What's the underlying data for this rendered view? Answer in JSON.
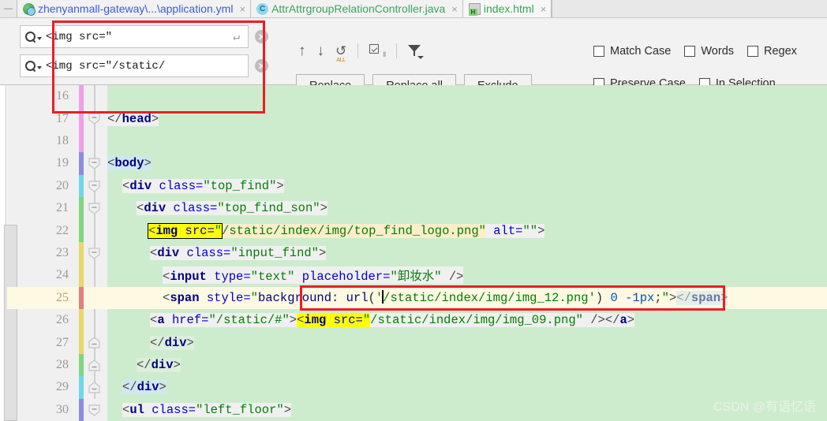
{
  "tabs": [
    {
      "label": "zhenyanmall-gateway\\...\\application.yml",
      "icon": "yml-file-icon",
      "close": "×",
      "active": false
    },
    {
      "label": "AttrAttrgroupRelationController.java",
      "icon": "java-class-icon",
      "close": "×",
      "active": false
    },
    {
      "label": "index.html",
      "icon": "html-file-icon",
      "close": "×",
      "active": true
    }
  ],
  "find": {
    "search_value": "<img src=\"",
    "replace_value": "<img src=\"/static/",
    "search_icon": "magnifier-dropdown-icon",
    "enter_icon": "↵",
    "clear_icon": "✕",
    "nav": {
      "prev_icon": "↑",
      "next_icon": "↓",
      "all_icon": "find-all-icon",
      "all_label": "ALL",
      "select_all_icon": "select-all-occurrences-icon",
      "filter_icon": "filter-icon"
    },
    "buttons": {
      "replace": "Replace",
      "replace_all": "Replace all",
      "exclude": "Exclude"
    },
    "options": [
      {
        "label": "Match Case",
        "checked": false
      },
      {
        "label": "Words",
        "checked": false
      },
      {
        "label": "Regex",
        "checked": false
      },
      {
        "label": "Preserve Case",
        "checked": false
      },
      {
        "label": "In Selection",
        "checked": false
      }
    ]
  },
  "editor": {
    "first_line": 16,
    "current_line": 25,
    "lines": [
      {
        "n": 16,
        "stripe": "#f0a0e8",
        "fold": "none",
        "text": ""
      },
      {
        "n": 17,
        "stripe": "#f0a0e8",
        "fold": "minus",
        "text": "</head>"
      },
      {
        "n": 18,
        "stripe": "#f0a0e8",
        "fold": "none",
        "text": ""
      },
      {
        "n": 19,
        "stripe": "#8c8ce0",
        "fold": "minus",
        "text": "<body>"
      },
      {
        "n": 20,
        "stripe": "#6fd8e8",
        "fold": "minus",
        "text": "    <div class=\"top_find\">"
      },
      {
        "n": 21,
        "stripe": "#7fd67f",
        "fold": "minus",
        "text": "        <div class=\"top_find_son\">"
      },
      {
        "n": 22,
        "stripe": "#7fd67f",
        "fold": "none",
        "text": "            <img src=\"/static/index/img/top_find_logo.png\" alt=\"\">"
      },
      {
        "n": 23,
        "stripe": "#e8d86a",
        "fold": "minus",
        "text": "            <div class=\"input_find\">"
      },
      {
        "n": 24,
        "stripe": "#e8d86a",
        "fold": "none",
        "text": "                <input type=\"text\" placeholder=\"卸妆水\" />"
      },
      {
        "n": 25,
        "stripe": "#e08080",
        "fold": "none",
        "text": "                <span style=\"background: url('/static/index/img/img_12.png') 0 -1px;\"></span>"
      },
      {
        "n": 26,
        "stripe": "#e8d86a",
        "fold": "none",
        "text": "                <a href=\"/static/#\"><img src=\"/static/index/img/img_09.png\" /></a>"
      },
      {
        "n": 27,
        "stripe": "#e8d86a",
        "fold": "plus",
        "text": "            </div>"
      },
      {
        "n": 28,
        "stripe": "#7fd67f",
        "fold": "plus",
        "text": "        </div>"
      },
      {
        "n": 29,
        "stripe": "#6fd8e8",
        "fold": "plus",
        "text": "    </div>"
      },
      {
        "n": 30,
        "stripe": "#8c8ce0",
        "fold": "minus",
        "text": "    <ul class=\"left_floor\">"
      }
    ],
    "current_match": "<img src=\"",
    "caret_position_line": 25
  },
  "annotations": {
    "box_color": "#ee1c25",
    "box_count": 2
  },
  "watermark": "CSDN @有语忆语",
  "colors": {
    "search_highlight": "#ffff00",
    "editor_background": "#cdeccd",
    "gutter_background": "#f0f0f0",
    "current_line": "#fdf9e3",
    "annotation_red": "#ee1c25"
  }
}
